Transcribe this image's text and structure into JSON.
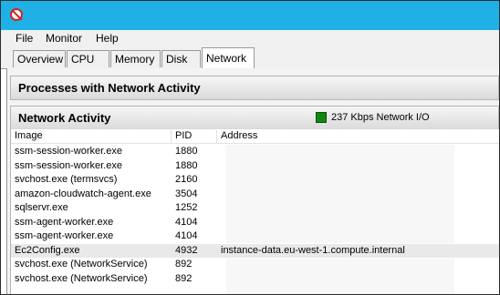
{
  "menu": [
    "File",
    "Monitor",
    "Help"
  ],
  "tabs": [
    {
      "label": "Overview",
      "active": false
    },
    {
      "label": "CPU",
      "active": false
    },
    {
      "label": "Memory",
      "active": false
    },
    {
      "label": "Disk",
      "active": false
    },
    {
      "label": "Network",
      "active": true
    }
  ],
  "sections": {
    "processes_title": "Processes with Network Activity",
    "network_title": "Network Activity",
    "network_io": "237 Kbps Network I/O"
  },
  "table": {
    "columns": [
      "Image",
      "PID",
      "Address"
    ],
    "rows": [
      {
        "image": "ssm-session-worker.exe",
        "pid": "1880",
        "address": ""
      },
      {
        "image": "ssm-session-worker.exe",
        "pid": "1880",
        "address": ""
      },
      {
        "image": "svchost.exe (termsvcs)",
        "pid": "2160",
        "address": ""
      },
      {
        "image": "amazon-cloudwatch-agent.exe",
        "pid": "3504",
        "address": ""
      },
      {
        "image": "sqlservr.exe",
        "pid": "1252",
        "address": ""
      },
      {
        "image": "ssm-agent-worker.exe",
        "pid": "4104",
        "address": ""
      },
      {
        "image": "ssm-agent-worker.exe",
        "pid": "4104",
        "address": ""
      },
      {
        "image": "Ec2Config.exe",
        "pid": "4932",
        "address": "instance-data.eu-west-1.compute.internal",
        "highlight": true
      },
      {
        "image": "svchost.exe (NetworkService)",
        "pid": "892",
        "address": ""
      },
      {
        "image": "svchost.exe (NetworkService)",
        "pid": "892",
        "address": ""
      }
    ]
  },
  "colors": {
    "titlebar": "#1fb1e6",
    "indicator": "#0d8a0d"
  }
}
